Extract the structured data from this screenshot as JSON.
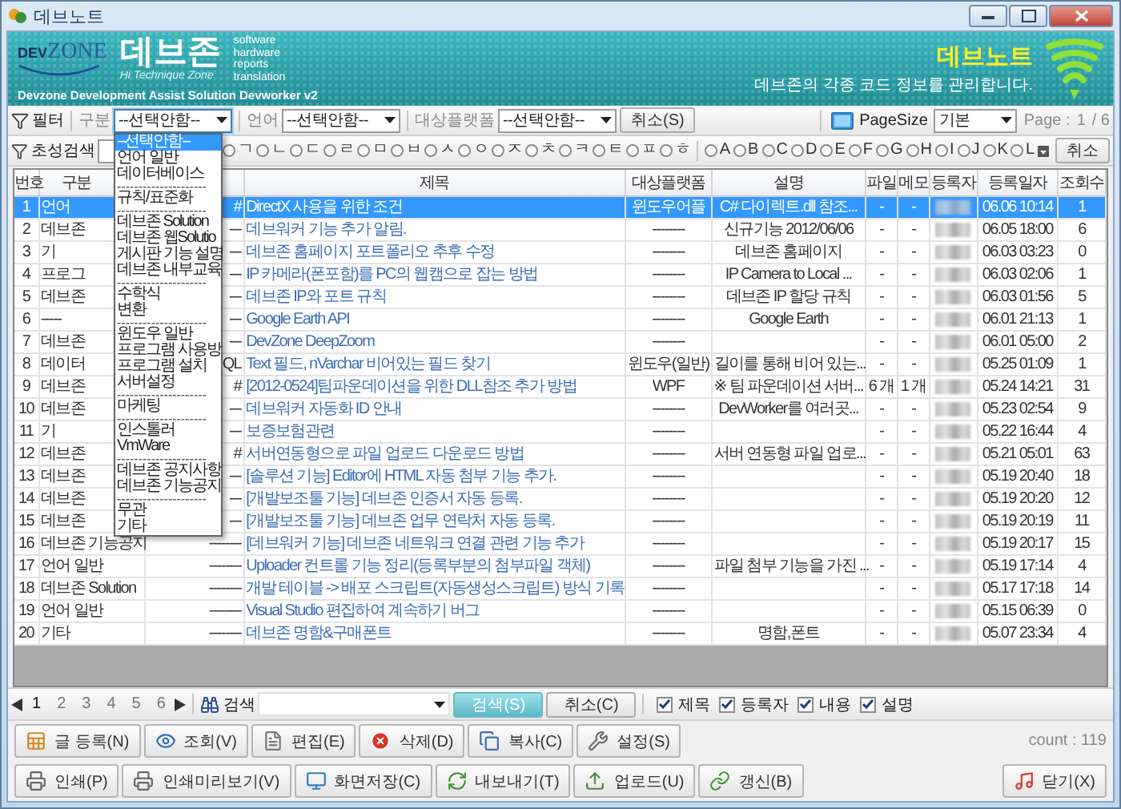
{
  "window": {
    "title": "데브노트"
  },
  "banner": {
    "logo_dev": "DEV",
    "logo_zone": "ZONE",
    "brand": "데브존",
    "tagline": "Hi Technique Zone",
    "keywords": [
      "software",
      "hardware",
      "reports",
      "translation"
    ],
    "subtitle": "Devzone Development Assist Solution Devworker v2",
    "app_name": "데브노트",
    "description": "데브존의 각종 코드 정보를 관리합니다."
  },
  "filter_bar": {
    "label": "필터",
    "fields": [
      {
        "label": "구분",
        "value": "--선택안함--",
        "open": true,
        "options": [
          {
            "label": "--선택안함--",
            "kind": "option",
            "selected": true
          },
          {
            "label": "언어 일반",
            "kind": "option",
            "selected": false
          },
          {
            "label": "데이터베이스",
            "kind": "option",
            "selected": false
          },
          {
            "label": "---------------------",
            "kind": "separator"
          },
          {
            "label": "규칙/표준화",
            "kind": "option",
            "selected": false
          },
          {
            "label": "---------------------",
            "kind": "separator"
          },
          {
            "label": "데브존 Solution",
            "kind": "option",
            "selected": false
          },
          {
            "label": "데브존 웹Solutio",
            "kind": "option",
            "selected": false
          },
          {
            "label": "게시판 기능 설명",
            "kind": "option",
            "selected": false
          },
          {
            "label": "데브존 내부교육",
            "kind": "option",
            "selected": false
          },
          {
            "label": "---------------------",
            "kind": "separator"
          },
          {
            "label": "수학식",
            "kind": "option",
            "selected": false
          },
          {
            "label": "변환",
            "kind": "option",
            "selected": false
          },
          {
            "label": "---------------------",
            "kind": "separator"
          },
          {
            "label": "윈도우 일반",
            "kind": "option",
            "selected": false
          },
          {
            "label": "프로그램 사용방",
            "kind": "option",
            "selected": false
          },
          {
            "label": "프로그램 설치",
            "kind": "option",
            "selected": false
          },
          {
            "label": "서버설정",
            "kind": "option",
            "selected": false
          },
          {
            "label": "---------------------",
            "kind": "separator"
          },
          {
            "label": "마케팅",
            "kind": "option",
            "selected": false
          },
          {
            "label": "---------------------",
            "kind": "separator"
          },
          {
            "label": "인스톨러",
            "kind": "option",
            "selected": false
          },
          {
            "label": "VmWare",
            "kind": "option",
            "selected": false
          },
          {
            "label": "---------------------",
            "kind": "separator"
          },
          {
            "label": "데브존 공지사항",
            "kind": "option",
            "selected": false
          },
          {
            "label": "데브존 기능공지",
            "kind": "option",
            "selected": false
          },
          {
            "label": "---------------------",
            "kind": "separator"
          },
          {
            "label": "무관",
            "kind": "option",
            "selected": false
          },
          {
            "label": "기타",
            "kind": "option",
            "selected": false
          }
        ]
      },
      {
        "label": "언어",
        "value": "--선택안함--",
        "open": false
      },
      {
        "label": "대상플랫폼",
        "value": "--선택안함--",
        "open": false
      }
    ],
    "cancel": "취소(S)",
    "page_size_label": "PageSize",
    "page_size": "기본",
    "page_label": "Page :",
    "page": "1",
    "page_total": "/ 6"
  },
  "initial_bar": {
    "label": "초성검색",
    "initials": [
      {
        "label": "ㄱ",
        "selected": false
      },
      {
        "label": "ㄴ",
        "selected": false
      },
      {
        "label": "ㄷ",
        "selected": false
      },
      {
        "label": "ㄹ",
        "selected": false
      },
      {
        "label": "ㅁ",
        "selected": false
      },
      {
        "label": "ㅂ",
        "selected": false
      },
      {
        "label": "ㅅ",
        "selected": false
      },
      {
        "label": "ㅇ",
        "selected": false
      },
      {
        "label": "ㅈ",
        "selected": false
      },
      {
        "label": "ㅊ",
        "selected": false
      },
      {
        "label": "ㅋ",
        "selected": false
      },
      {
        "label": "ㅌ",
        "selected": false
      },
      {
        "label": "ㅍ",
        "selected": false
      },
      {
        "label": "ㅎ",
        "selected": false
      }
    ],
    "letters": [
      {
        "label": "A",
        "selected": false
      },
      {
        "label": "B",
        "selected": false
      },
      {
        "label": "C",
        "selected": false
      },
      {
        "label": "D",
        "selected": false
      },
      {
        "label": "E",
        "selected": false
      },
      {
        "label": "F",
        "selected": false
      },
      {
        "label": "G",
        "selected": false
      },
      {
        "label": "H",
        "selected": false
      },
      {
        "label": "I",
        "selected": false
      },
      {
        "label": "J",
        "selected": false
      },
      {
        "label": "K",
        "selected": false
      },
      {
        "label": "L",
        "selected": false
      }
    ],
    "cancel": "취소"
  },
  "table": {
    "columns": [
      {
        "label": "번호"
      },
      {
        "label": "구분"
      },
      {},
      {
        "label": "제목"
      },
      {
        "label": "대상플랫폼"
      },
      {
        "label": "설명"
      },
      {
        "label": "파일"
      },
      {
        "label": "메모"
      },
      {
        "label": "등록자"
      },
      {
        "label": "등록일자"
      },
      {
        "label": "조회수"
      }
    ],
    "rows": [
      {
        "no": "1",
        "category": "언어",
        "language": "#",
        "title": "DirectX 사용을 위한 조건",
        "platform": "윈도우어플",
        "description": "C# 다이렉트.dll 참조...",
        "file": "-",
        "memo": "-",
        "date": "06.06 10:14",
        "views": "1",
        "selected": true
      },
      {
        "no": "2",
        "category": "데브존",
        "language": "---",
        "title": "데브워커 기능 추가 알림.",
        "platform": "--------",
        "description": "신규기능 2012/06/06",
        "file": "-",
        "memo": "-",
        "date": "06.05 18:00",
        "views": "6",
        "selected": false
      },
      {
        "no": "3",
        "category": "기",
        "language": "---",
        "title": "데브존 홈페이지 포트폴리오 추후 수정",
        "platform": "--------",
        "description": "데브존 홈페이지",
        "file": "-",
        "memo": "-",
        "date": "06.03 03:23",
        "views": "0",
        "selected": false
      },
      {
        "no": "4",
        "category": "프로그",
        "language": "---",
        "title": "IP 카메라(폰포함)를 PC의 웹캠으로 잡는 방법",
        "platform": "--------",
        "description": "IP Camera to Local ...",
        "file": "-",
        "memo": "-",
        "date": "06.03 02:06",
        "views": "1",
        "selected": false
      },
      {
        "no": "5",
        "category": "데브존",
        "language": "---",
        "title": "데브존 IP와 포트 규칙",
        "platform": "--------",
        "description": "데브존 IP 할당 규칙",
        "file": "-",
        "memo": "-",
        "date": "06.03 01:56",
        "views": "5",
        "selected": false
      },
      {
        "no": "6",
        "category": "-----",
        "language": "---",
        "title": "Google Earth API",
        "platform": "--------",
        "description": "Google Earth",
        "file": "-",
        "memo": "-",
        "date": "06.01 21:13",
        "views": "1",
        "selected": false
      },
      {
        "no": "7",
        "category": "데브존",
        "language": "---",
        "title": "DevZone DeepZoom",
        "platform": "--------",
        "file": "-",
        "memo": "-",
        "date": "06.01 05:00",
        "views": "2",
        "selected": false
      },
      {
        "no": "8",
        "category": "데이터",
        "language": "QL",
        "title": "Text 필드, nVarchar 비어있는 필드 찾기",
        "platform": "윈도우(일반)",
        "description": "길이를 통해 비어 있는...",
        "file": "-",
        "memo": "-",
        "date": "05.25 01:09",
        "views": "1",
        "selected": false
      },
      {
        "no": "9",
        "category": "데브존",
        "language": "#",
        "title": "[2012-0524]팀파운데이션을 위한 DLL참조 추가 방법",
        "platform": "WPF",
        "description": "※ 팀 파운데이션 서버...",
        "file": "6 개",
        "memo": "1 개",
        "date": "05.24 14:21",
        "views": "31",
        "selected": false
      },
      {
        "no": "10",
        "category": "데브존",
        "language": "---",
        "title": "데브워커 자동화 ID 안내",
        "platform": "--------",
        "description": "DevWorker를 여러곳...",
        "file": "-",
        "memo": "-",
        "date": "05.23 02:54",
        "views": "9",
        "selected": false
      },
      {
        "no": "11",
        "category": "기",
        "language": "---",
        "title": "보증보험관련",
        "platform": "--------",
        "file": "-",
        "memo": "-",
        "date": "05.22 16:44",
        "views": "4",
        "selected": false
      },
      {
        "no": "12",
        "category": "데브존",
        "language": "#",
        "title": "서버연동형으로 파일 업로드 다운로드 방법",
        "platform": "--------",
        "description": "서버 연동형 파일 업로...",
        "file": "-",
        "memo": "-",
        "date": "05.21 05:01",
        "views": "63",
        "selected": false
      },
      {
        "no": "13",
        "category": "데브존",
        "language": "---",
        "title": "[솔루션 기능] Editor에 HTML 자동 첨부 기능 추가.",
        "platform": "--------",
        "file": "-",
        "memo": "-",
        "date": "05.19 20:40",
        "views": "18",
        "selected": false
      },
      {
        "no": "14",
        "category": "데브존",
        "language": "---",
        "title": "[개발보조툴 기능] 데브존 인증서 자동 등록.",
        "platform": "--------",
        "file": "-",
        "memo": "-",
        "date": "05.19 20:20",
        "views": "12",
        "selected": false
      },
      {
        "no": "15",
        "category": "데브존",
        "language": "---",
        "title": "[개발보조툴 기능] 데브존 업무 연락처 자동 등록.",
        "platform": "--------",
        "file": "-",
        "memo": "-",
        "date": "05.19 20:19",
        "views": "11",
        "selected": false
      },
      {
        "no": "16",
        "category": "데브존 기능공지",
        "language": "--------",
        "title": "[데브워커 기능] 데브존 네트워크 연결 관련 기능 추가",
        "platform": "--------",
        "file": "-",
        "memo": "-",
        "date": "05.19 20:17",
        "views": "15",
        "selected": false
      },
      {
        "no": "17",
        "category": "언어 일반",
        "language": "--------",
        "title": "Uploader 컨트롤 기능 정리(등록부분의 첨부파일 객체)",
        "platform": "--------",
        "description": "파일 첨부 기능을 가진 ...",
        "file": "-",
        "memo": "-",
        "date": "05.19 17:14",
        "views": "4",
        "selected": false
      },
      {
        "no": "18",
        "category": "데브존 Solution",
        "language": "--------",
        "title": "개발 테이블 -> 배포 스크립트(자동생성스크립트) 방식 기록",
        "platform": "--------",
        "file": "-",
        "memo": "-",
        "date": "05.17 17:18",
        "views": "14",
        "selected": false
      },
      {
        "no": "19",
        "category": "언어 일반",
        "language": "--------",
        "title": "Visual Studio 편집하여 계속하기 버그",
        "platform": "--------",
        "file": "-",
        "memo": "-",
        "date": "05.15 06:39",
        "views": "0",
        "selected": false
      },
      {
        "no": "20",
        "category": "기타",
        "language": "--------",
        "title": "데브존 명함&구매폰트",
        "platform": "--------",
        "description": "명함,폰트",
        "file": "-",
        "memo": "-",
        "date": "05.07 23:34",
        "views": "4",
        "selected": false
      }
    ]
  },
  "pager": {
    "pages": [
      {
        "label": "1",
        "selected": true
      },
      {
        "label": "2",
        "selected": false
      },
      {
        "label": "3",
        "selected": false
      },
      {
        "label": "4",
        "selected": false
      },
      {
        "label": "5",
        "selected": false
      },
      {
        "label": "6",
        "selected": false
      }
    ],
    "search_label": "검색",
    "search_button": "검색(S)",
    "cancel_button": "취소(C)",
    "options": [
      {
        "label": "제목",
        "checked": true
      },
      {
        "label": "등록자",
        "checked": true
      },
      {
        "label": "내용",
        "checked": true
      },
      {
        "label": "설명",
        "checked": true
      }
    ]
  },
  "actions": [
    "글 등록(N)",
    "조회(V)",
    "편집(E)",
    "삭제(D)",
    "복사(C)",
    "설정(S)"
  ],
  "count": "count : 119",
  "actions_2": [
    "인쇄(P)",
    "인쇄미리보기(V)",
    "화면저장(C)",
    "내보내기(T)",
    "업로드(U)",
    "갱신(B)"
  ],
  "close": "닫기(X)"
}
